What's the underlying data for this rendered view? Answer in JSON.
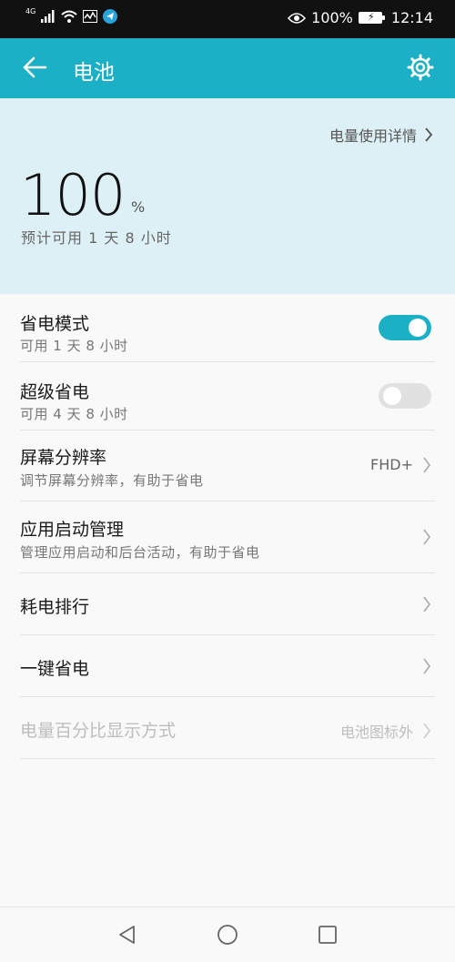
{
  "status_bar": {
    "network": "4G",
    "battery_percent": "100%",
    "time": "12:14"
  },
  "app_bar": {
    "title": "电池"
  },
  "summary": {
    "details_link": "电量使用详情",
    "battery_level": "100",
    "percent_sign": "%",
    "estimate": "预计可用 1 天 8 小时"
  },
  "settings": {
    "power_saving": {
      "title": "省电模式",
      "subtitle": "可用 1 天 8 小时",
      "enabled": true
    },
    "ultra_power_saving": {
      "title": "超级省电",
      "subtitle": "可用 4 天 8 小时",
      "enabled": false
    },
    "screen_resolution": {
      "title": "屏幕分辨率",
      "subtitle": "调节屏幕分辨率，有助于省电",
      "value": "FHD+"
    },
    "app_launch": {
      "title": "应用启动管理",
      "subtitle": "管理应用启动和后台活动，有助于省电"
    },
    "consumption_ranking": {
      "title": "耗电排行"
    },
    "one_tap_saving": {
      "title": "一键省电"
    },
    "percentage_display": {
      "title": "电量百分比显示方式",
      "value": "电池图标外"
    }
  },
  "colors": {
    "accent": "#1cb0c6",
    "summary_bg": "#dcf0f5"
  }
}
